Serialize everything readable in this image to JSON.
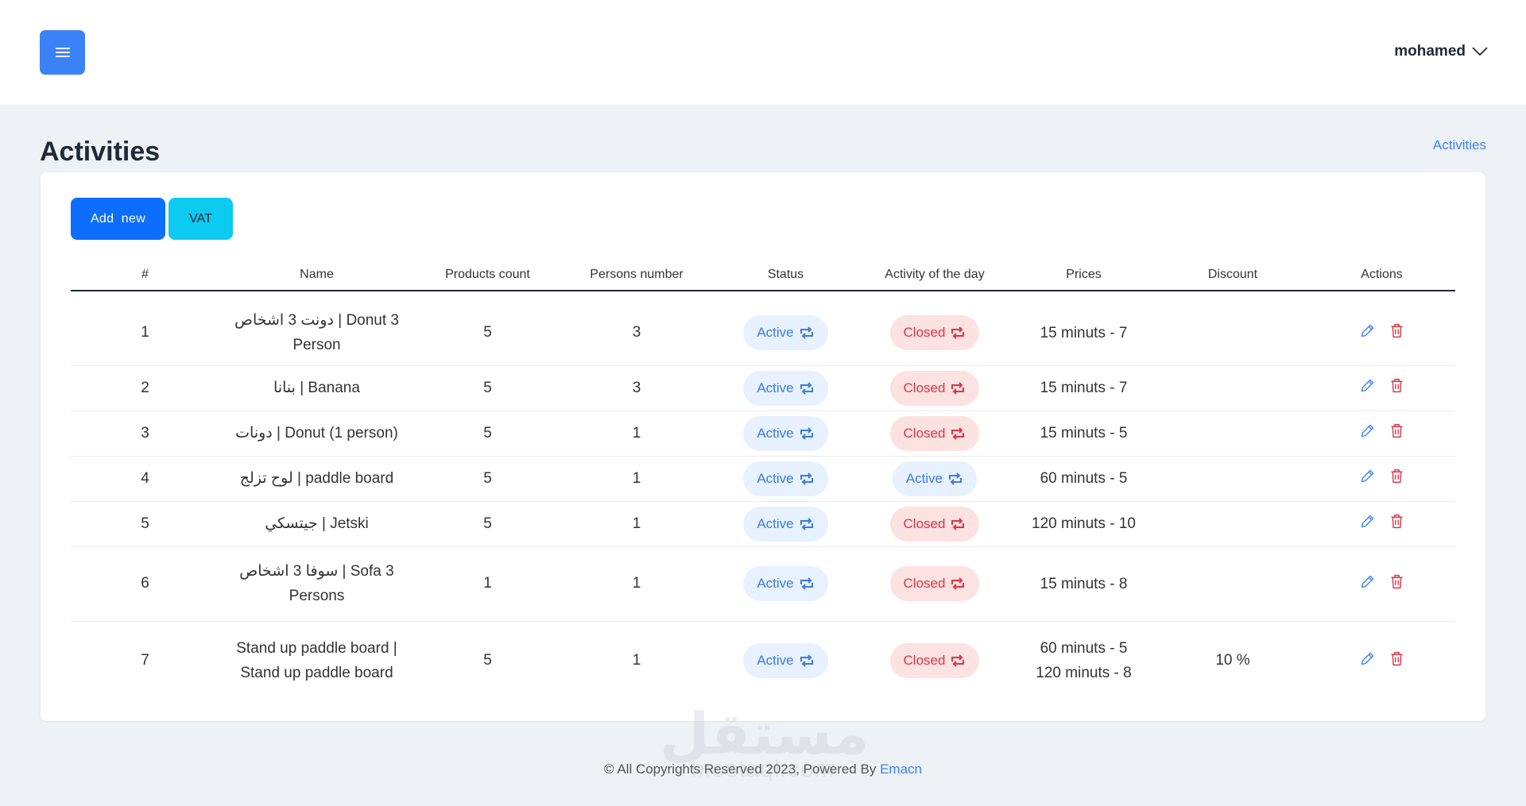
{
  "header": {
    "user_name": "mohamed"
  },
  "page": {
    "title": "Activities",
    "breadcrumb": "Activities"
  },
  "toolbar": {
    "add_label": "Add  new",
    "vat_label": "VAT"
  },
  "table": {
    "columns": [
      "#",
      "Name",
      "Products count",
      "Persons number",
      "Status",
      "Activity of the day",
      "Prices",
      "Discount",
      "Actions"
    ],
    "rows": [
      {
        "num": "1",
        "name": "دونت 3 اشخاص | Donut 3 Person",
        "products": "5",
        "persons": "3",
        "status": "Active",
        "status_state": "active",
        "day": "Closed",
        "day_state": "closed",
        "prices": [
          "15 minuts - 7"
        ],
        "discount": ""
      },
      {
        "num": "2",
        "name": "بنانا | Banana",
        "products": "5",
        "persons": "3",
        "status": "Active",
        "status_state": "active",
        "day": "Closed",
        "day_state": "closed",
        "prices": [
          "15 minuts - 7"
        ],
        "discount": ""
      },
      {
        "num": "3",
        "name": "دونات | Donut (1 person)",
        "products": "5",
        "persons": "1",
        "status": "Active",
        "status_state": "active",
        "day": "Closed",
        "day_state": "closed",
        "prices": [
          "15 minuts - 5"
        ],
        "discount": ""
      },
      {
        "num": "4",
        "name": "لوح تزلج | paddle board",
        "products": "5",
        "persons": "1",
        "status": "Active",
        "status_state": "active",
        "day": "Active",
        "day_state": "active",
        "prices": [
          "60 minuts - 5"
        ],
        "discount": ""
      },
      {
        "num": "5",
        "name": "جيتسكي | Jetski",
        "products": "5",
        "persons": "1",
        "status": "Active",
        "status_state": "active",
        "day": "Closed",
        "day_state": "closed",
        "prices": [
          "120 minuts - 10"
        ],
        "discount": ""
      },
      {
        "num": "6",
        "name": "سوفا 3 اشخاص | Sofa 3 Persons",
        "products": "1",
        "persons": "1",
        "status": "Active",
        "status_state": "active",
        "day": "Closed",
        "day_state": "closed",
        "prices": [
          "15 minuts - 8"
        ],
        "discount": ""
      },
      {
        "num": "7",
        "name": "Stand up paddle board | Stand up paddle board",
        "products": "5",
        "persons": "1",
        "status": "Active",
        "status_state": "active",
        "day": "Closed",
        "day_state": "closed",
        "prices": [
          "60 minuts - 5",
          "120 minuts - 8"
        ],
        "discount": "10 %"
      }
    ]
  },
  "icons": {
    "menu": "menu-icon",
    "chevron": "chevron-down-icon",
    "toggle": "swap-icon",
    "edit": "pencil-icon",
    "delete": "trash-icon"
  },
  "colors": {
    "primary": "#3b82f6",
    "add_button": "#0d6efd",
    "vat_button": "#0dcaf0",
    "active_bg": "#e7f1ff",
    "active_text": "#3b7ddd",
    "closed_bg": "#fde2e2",
    "closed_text": "#dc3545",
    "edit_icon": "#3b82f6",
    "delete_icon": "#dc3545"
  },
  "footer": {
    "text": "© All Copyrights Reserved 2023, Powered By",
    "link": "Emacn"
  },
  "watermark": {
    "logo": "مستقل",
    "text": "mostaql.com"
  }
}
